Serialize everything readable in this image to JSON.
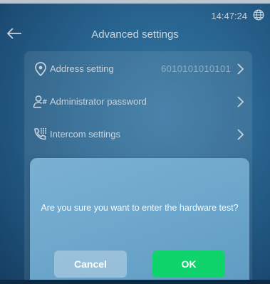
{
  "status_bar": {
    "time": "14:47:24"
  },
  "header": {
    "title": "Advanced settings"
  },
  "settings": {
    "items": [
      {
        "label": "Address setting",
        "value": "6010101010101",
        "icon": "location-pin-icon"
      },
      {
        "label": "Administrator password",
        "value": "",
        "icon": "admin-user-icon"
      },
      {
        "label": "Intercom settings",
        "value": "",
        "icon": "phone-keypad-icon"
      }
    ]
  },
  "dialog": {
    "message": "Are you sure you want to enter the hardware test?",
    "cancel_label": "Cancel",
    "ok_label": "OK"
  },
  "colors": {
    "background": "#2d6f9e",
    "ok_button": "#0fd36b",
    "text": "#ffffff"
  }
}
